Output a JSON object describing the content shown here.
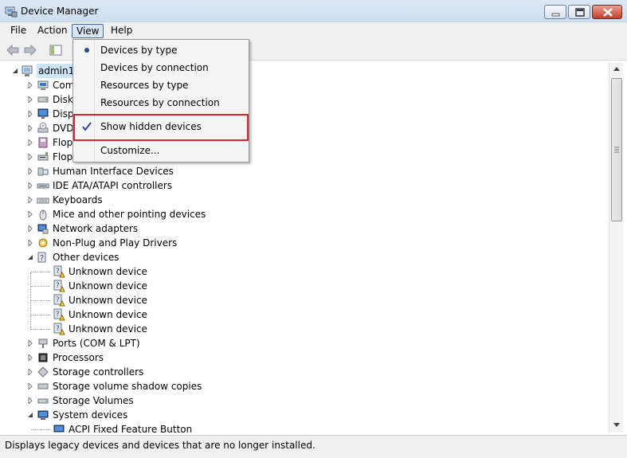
{
  "window": {
    "title": "Device Manager"
  },
  "menubar": {
    "file": "File",
    "action": "Action",
    "view": "View",
    "help": "Help"
  },
  "view_menu": {
    "items": [
      {
        "label": "Devices by type",
        "mark": "radio-bullet"
      },
      {
        "label": "Devices by connection",
        "mark": ""
      },
      {
        "label": "Resources by type",
        "mark": ""
      },
      {
        "label": "Resources by connection",
        "mark": ""
      },
      {
        "label": "Show hidden devices",
        "mark": "checkmark"
      },
      {
        "label": "Customize...",
        "mark": ""
      }
    ]
  },
  "tree": {
    "root": "admin1-",
    "nodes": [
      {
        "label": "Com",
        "icon": "computer-icon"
      },
      {
        "label": "Disk",
        "icon": "disk-drive-icon"
      },
      {
        "label": "Disp",
        "icon": "display-adapter-icon"
      },
      {
        "label": "DVD",
        "icon": "dvd-drive-icon"
      },
      {
        "label": "Flop",
        "icon": "floppy-controller-icon"
      },
      {
        "label": "Flopp",
        "icon": "floppy-drive-icon"
      },
      {
        "label": "Human Interface Devices",
        "icon": "hid-icon"
      },
      {
        "label": "IDE ATA/ATAPI controllers",
        "icon": "ide-controller-icon"
      },
      {
        "label": "Keyboards",
        "icon": "keyboard-icon"
      },
      {
        "label": "Mice and other pointing devices",
        "icon": "mouse-icon"
      },
      {
        "label": "Network adapters",
        "icon": "network-adapter-icon"
      },
      {
        "label": "Non-Plug and Play Drivers",
        "icon": "driver-icon"
      },
      {
        "label": "Other devices",
        "icon": "other-devices-icon",
        "expanded": true
      },
      {
        "label": "Unknown device",
        "icon": "unknown-device-warning-icon",
        "child": true
      },
      {
        "label": "Unknown device",
        "icon": "unknown-device-warning-icon",
        "child": true
      },
      {
        "label": "Unknown device",
        "icon": "unknown-device-warning-icon",
        "child": true
      },
      {
        "label": "Unknown device",
        "icon": "unknown-device-warning-icon",
        "child": true
      },
      {
        "label": "Unknown device",
        "icon": "unknown-device-warning-icon",
        "child": true
      },
      {
        "label": "Ports (COM & LPT)",
        "icon": "port-icon"
      },
      {
        "label": "Processors",
        "icon": "processor-icon"
      },
      {
        "label": "Storage controllers",
        "icon": "storage-controller-icon"
      },
      {
        "label": "Storage volume shadow copies",
        "icon": "shadow-copy-icon"
      },
      {
        "label": "Storage Volumes",
        "icon": "storage-volume-icon"
      },
      {
        "label": "System devices",
        "icon": "system-devices-icon",
        "expanded": true
      },
      {
        "label": "ACPI Fixed Feature Button",
        "icon": "system-device-icon",
        "child": true
      }
    ]
  },
  "statusbar": {
    "text": "Displays legacy devices and devices that are no longer installed."
  },
  "colors": {
    "highlight_box": "#e0242f",
    "selection": "#cde6f7"
  }
}
